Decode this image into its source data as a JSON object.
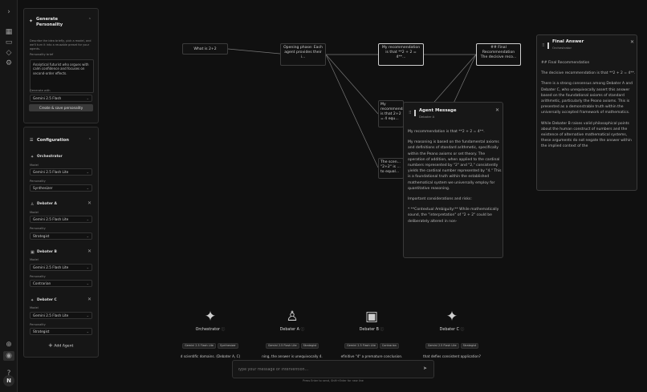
{
  "rail": {
    "expand_icon": "chevron-right-icon",
    "icons": [
      "grid-icon",
      "chat-icon",
      "tag-icon",
      "settings-icon"
    ],
    "avatar_initial": "N"
  },
  "generate": {
    "title": "Generate Personality",
    "description": "Describe the idea briefly, pick a model, and we'll turn it into a reusable preset for your agents.",
    "brief_label": "Personality brief",
    "brief_value": "Analytical futurist who argues with calm confidence and focuses on second-order effects.",
    "model_label": "Generate with",
    "model_value": "Gemini 2.5 Flash",
    "create_button": "Create & save personality"
  },
  "config": {
    "title": "Configuration",
    "model_label": "Model",
    "personality_label": "Personality",
    "orchestrator": {
      "name": "Orchestrator",
      "model": "Gemini 2.5 Flash Lite",
      "personality": "Synthesizer"
    },
    "agents": [
      {
        "name": "Debater A",
        "model": "Gemini 2.5 Flash Lite",
        "personality": "Strategist"
      },
      {
        "name": "Debater B",
        "model": "Gemini 2.5 Flash Lite",
        "personality": "Contrarian"
      },
      {
        "name": "Debater C",
        "model": "Gemini 2.5 Flash Lite",
        "personality": "Strategist"
      }
    ],
    "add_agent": "Add Agent"
  },
  "nodes": {
    "question": "What is 2+2",
    "opening": "Opening phase: Each agent provides their i...",
    "rec1": "My recommendation is that **2 + 2 = 4**...",
    "final": "## Final Recommendation The decisive reco...",
    "rec2_partial": "My recommendation is that 2+2 = 4 equ...",
    "rec3_partial": "The scen... \"2+2\" is ... to equal..."
  },
  "agent_message": {
    "title": "Agent Message",
    "subtitle": "Debater A",
    "paragraphs": [
      "My recommendation is that **2 + 2 = 4**.",
      "My reasoning is based on the fundamental axioms and definitions of standard arithmetic, specifically within the Peano axioms or set theory. The operation of addition, when applied to the cardinal numbers represented by \"2\" and \"2,\" consistently yields the cardinal number represented by \"4.\" This is a foundational truth within the established mathematical system we universally employ for quantitative reasoning.",
      "Important considerations and risks:",
      "* **Contextual Ambiguity:** While mathematically sound, the \"interpretation\" of \"2 + 2\" could be deliberately altered in non-"
    ]
  },
  "final_answer": {
    "title": "Final Answer",
    "subtitle": "Orchestrator",
    "paragraphs": [
      "## Final Recommendation",
      "The decisive recommendation is that **2 + 2 = 4**.",
      "There is a strong consensus among Debater A and Debater C, who unequivocally assert this answer based on the foundational axioms of standard arithmetic, particularly the Peano axioms. This is presented as a demonstrable truth within the universally accepted framework of mathematics.",
      "While Debater B raises valid philosophical points about the human construct of numbers and the existence of alternative mathematical systems, these arguments do not negate the answer within the implied context of the"
    ]
  },
  "avatars": [
    {
      "name": "Orchestrator",
      "glyph": "sparkles-icon",
      "model": "Gemini 2.5 Flash Lite",
      "personality": "Synthesizer",
      "message": "d scientific domains. (Debater A, C)"
    },
    {
      "name": "Debater A",
      "glyph": "person-icon",
      "model": "Gemini 2.5 Flash Lite",
      "personality": "Strategist",
      "message": "ning, the answer is unequivocally 4."
    },
    {
      "name": "Debater B",
      "glyph": "robot-icon",
      "model": "Gemini 2.5 Flash Lite",
      "personality": "Contrarian",
      "message": "efinitive \"4\" a premature conclusion."
    },
    {
      "name": "Debater C",
      "glyph": "sparkles-icon",
      "model": "Gemini 2.5 Flash Lite",
      "personality": "Strategist",
      "message": "that defies consistent application?"
    }
  ],
  "composer": {
    "placeholder": "Type your message or intervention...",
    "hint": "Press Enter to send, Shift+Enter for new line"
  }
}
